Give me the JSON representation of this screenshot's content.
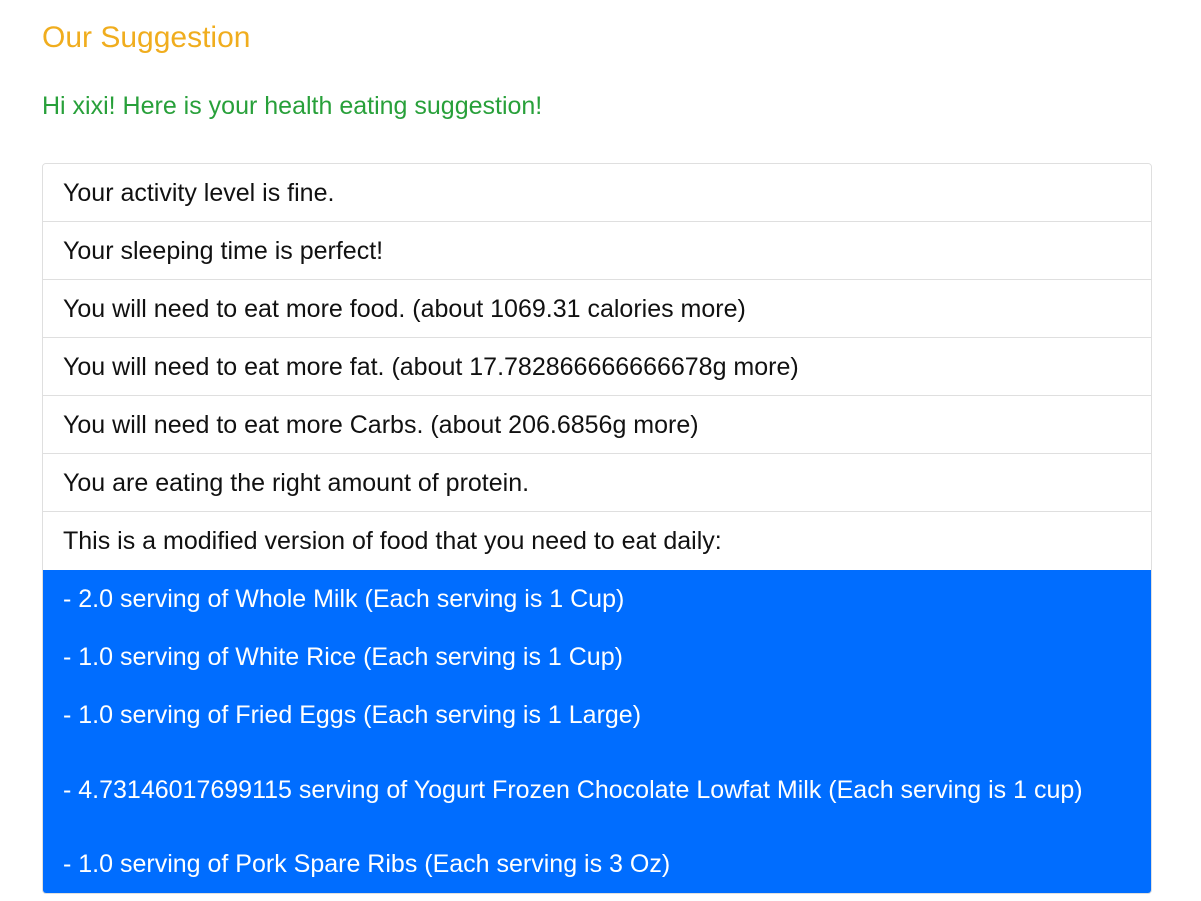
{
  "header": {
    "title": "Our Suggestion",
    "greeting": "Hi xixi! Here is your health eating suggestion!"
  },
  "suggestions": [
    "Your activity level is fine.",
    "Your sleeping time is perfect!",
    "You will need to eat more food. (about 1069.31 calories more)",
    "You will need to eat more fat. (about 17.782866666666678g more)",
    "You will need to eat more Carbs. (about 206.6856g more)",
    "You are eating the right amount of protein.",
    "This is a modified version of food that you need to eat daily:"
  ],
  "foods": [
    "- 2.0 serving of Whole Milk (Each serving is 1 Cup)",
    "- 1.0 serving of White Rice (Each serving is 1 Cup)",
    "- 1.0 serving of Fried Eggs (Each serving is 1 Large)",
    "- 4.73146017699115 serving of Yogurt Frozen Chocolate Lowfat Milk (Each serving is 1 cup)",
    "- 1.0 serving of Pork Spare Ribs (Each serving is 3 Oz)"
  ],
  "colors": {
    "title": "#f0ad1e",
    "greeting": "#28a03a",
    "active_bg": "#006dff",
    "border": "#dfdfdf"
  }
}
